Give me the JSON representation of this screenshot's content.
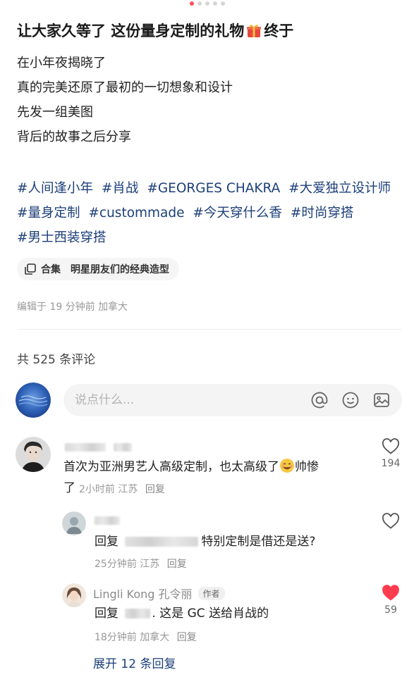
{
  "carousel": {
    "count": 5,
    "active": 0
  },
  "post": {
    "title_before": "让大家久等了 这份量身定制的礼物",
    "title_after": "终于",
    "lines": [
      "在小年夜揭晓了",
      "真的完美还原了最初的一切想象和设计",
      "先发一组美图",
      "背后的故事之后分享"
    ],
    "tags": [
      "#人间逢小年",
      "#肖战",
      "#GEORGES CHAKRA",
      "#大爱独立设计师",
      "#量身定制",
      "#custommade",
      "#今天穿什么香",
      "#时尚穿搭",
      "#男士西装穿搭"
    ],
    "collection_label": "合集",
    "collection_name": "明星朋友们的经典造型",
    "edit_info": "编辑于 19 分钟前 加拿大"
  },
  "comments_header": {
    "count_text": "共 525 条评论"
  },
  "comment_input": {
    "placeholder": "说点什么..."
  },
  "comments": [
    {
      "text_a": "首次为亚洲男艺人高级定制，也太高级了",
      "text_b": "帅惨",
      "text_c": "了",
      "time": "2小时前",
      "location": "江苏",
      "reply_label": "回复",
      "likes": "194",
      "liked": false
    },
    {
      "reply_prefix": "回复",
      "text": "特别定制是借还是送?",
      "time": "25分钟前",
      "location": "江苏",
      "reply_label": "回复",
      "likes": "",
      "liked": false
    },
    {
      "author": "Lingli Kong 孔令丽",
      "badge": "作者",
      "reply_prefix": "回复",
      "text": "这是 GC 送给肖战的",
      "time": "18分钟前",
      "location": "加拿大",
      "reply_label": "回复",
      "likes": "59",
      "liked": true
    }
  ],
  "expand_replies": "展开 12 条回复",
  "colors": {
    "accent": "#ff4d5a",
    "link": "#1c3f7a",
    "muted": "#999999"
  }
}
